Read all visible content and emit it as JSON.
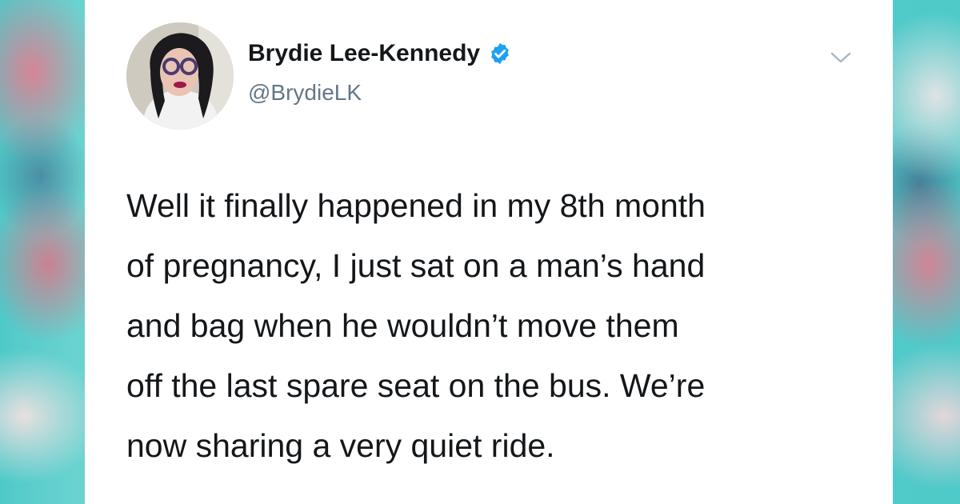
{
  "tweet": {
    "author": {
      "display_name": "Brydie Lee-Kennedy",
      "handle": "@BrydieLK",
      "verified": true,
      "avatar_icon": "profile-photo"
    },
    "menu_icon": "chevron-down-icon",
    "text_lines": [
      "Well it finally happened in my 8th month",
      "of pregnancy, I just sat on a man’s hand",
      "and bag when he wouldn’t move them",
      "off the last spare seat on the bus. We’re",
      "now sharing a very quiet ride."
    ]
  },
  "colors": {
    "name": "#14171a",
    "handle": "#657786",
    "verified_blue": "#1da1f2",
    "background_teal": "#4fc9c9",
    "background_pink": "#ec788c"
  }
}
